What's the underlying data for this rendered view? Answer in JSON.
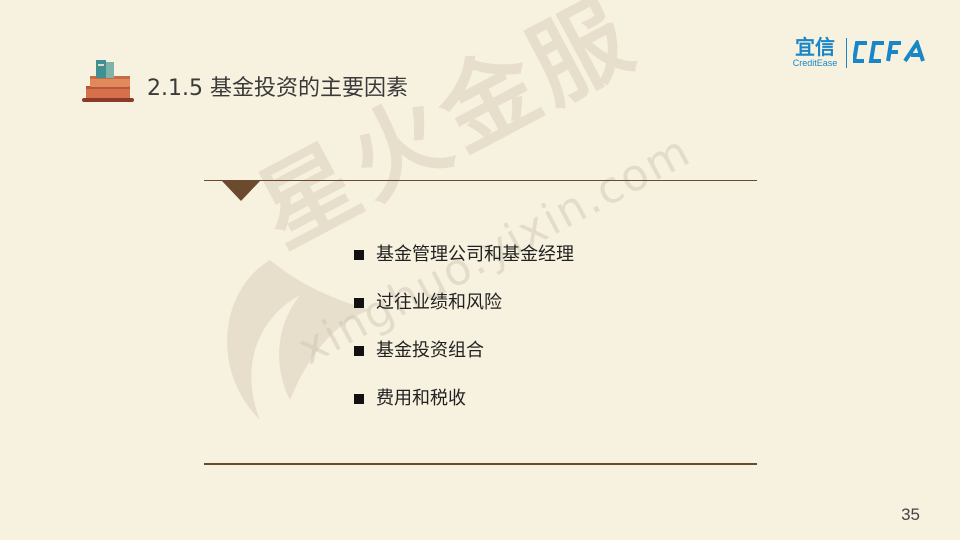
{
  "header": {
    "title": "2.1.5 基金投资的主要因素"
  },
  "logos": {
    "yixin_cn": "宜信",
    "yixin_en": "CreditEase",
    "ccfa": "CCFA"
  },
  "watermark": {
    "text": "星火金服",
    "sub": "xinghuo.yixin.com"
  },
  "bullets": [
    "基金管理公司和基金经理",
    "过往业绩和风险",
    "基金投资组合",
    "费用和税收"
  ],
  "page_number": "35",
  "colors": {
    "background": "#f7f1df",
    "rule": "#6b4a2e",
    "brand_blue": "#1a86c8",
    "text": "#222222"
  }
}
